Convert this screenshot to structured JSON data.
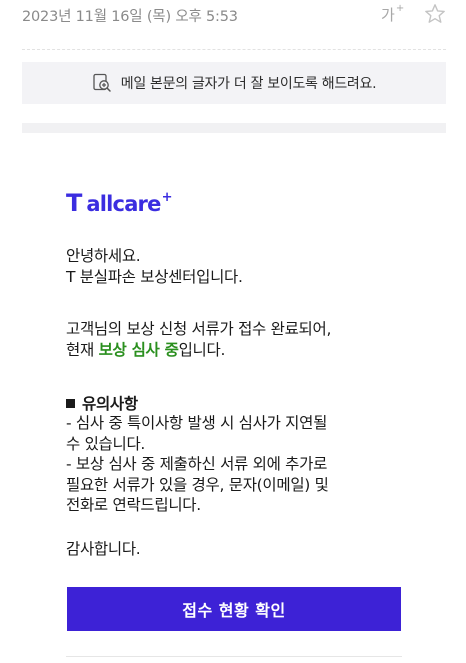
{
  "header": {
    "datetime": "2023년 11월 16일 (목) 오후 5:53",
    "font_size_label": "가",
    "font_size_plus": "+",
    "star_icon": "star-outline-icon"
  },
  "readability_banner": {
    "icon": "zoom-in-document-icon",
    "text": "메일 본문의 글자가 더 잘 보이도록 해드려요."
  },
  "logo": {
    "t": "T",
    "word": "allcare",
    "plus": "+",
    "color": "#3b2de0"
  },
  "body": {
    "greeting_lines": [
      "안녕하세요.",
      "T 분실파손 보상센터입니다."
    ],
    "status_line1": "고객님의 보상 신청 서류가 접수 완료되어,",
    "status_prefix": "현재 ",
    "status_highlight": "보상 심사 중",
    "status_suffix": "입니다.",
    "highlight_color": "#2a8f1e",
    "notice_title": "유의사항",
    "notice_lines": [
      "- 심사 중 특이사항 발생 시 심사가 지연될",
      "수 있습니다.",
      "- 보상 심사 중 제출하신 서류 외에 추가로",
      "필요한 서류가 있을 경우, 문자(이메일) 및",
      "전화로 연락드립니다."
    ],
    "closing": "감사합니다."
  },
  "cta": {
    "label": "접수 현황 확인",
    "color": "#3d22d6"
  }
}
